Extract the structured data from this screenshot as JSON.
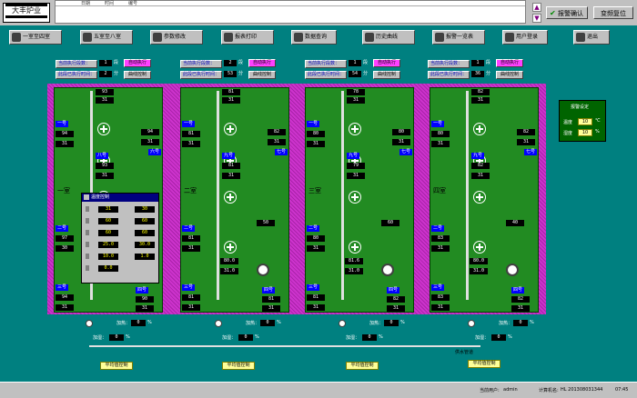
{
  "header": {
    "logo": "大丰炉业",
    "log_cols": [
      "日期",
      "时间",
      "编号"
    ],
    "ack_btn": "报警确认",
    "reset_btn": "变频复位"
  },
  "nav": [
    {
      "label": "一室至四室",
      "icon": "screen-icon"
    },
    {
      "label": "五室至八室",
      "icon": "screen-icon"
    },
    {
      "label": "参数修改",
      "icon": "wrench-icon"
    },
    {
      "label": "报表打印",
      "icon": "printer-icon"
    },
    {
      "label": "数据查询",
      "icon": "search-icon"
    },
    {
      "label": "历史曲线",
      "icon": "help-icon"
    },
    {
      "label": "报警一览表",
      "icon": "alarm-icon"
    },
    {
      "label": "用户登录",
      "icon": "key-icon"
    },
    {
      "label": "退出",
      "icon": "exit-icon"
    }
  ],
  "ctrl": {
    "l1": "当前执行段数：",
    "l2": "此段已执行时间：",
    "run": "自动执行",
    "curve": "曲线控制",
    "seg_unit": "段",
    "time_unit": "分",
    "rooms": [
      {
        "seg": "1",
        "time": "2"
      },
      {
        "seg": "2",
        "time": "53"
      },
      {
        "seg": "1",
        "time": "54"
      },
      {
        "seg": "1",
        "time": "36"
      }
    ]
  },
  "rooms": [
    {
      "name": "一室",
      "tag1": "一号",
      "v1": "94",
      "v2": "31",
      "tag2": "二号",
      "v3": "97",
      "v4": "30",
      "tag3": "三号",
      "v5": "94",
      "v6": "31",
      "t_mid": "93",
      "t_mid2": "31",
      "tr1": "94",
      "tr2": "31",
      "tag_r": "六号",
      "tag4": "八号",
      "v7": "93",
      "v8": "31",
      "tag_r3": "四号",
      "vr3": "90",
      "vr4": "31"
    },
    {
      "name": "二室",
      "tag1": "一号",
      "v1": "81",
      "v2": "31",
      "tag2": "二号",
      "v3": "81",
      "v4": "31",
      "tag3": "三号",
      "v5": "81",
      "v6": "31",
      "t_mid": "81",
      "t_mid2": "31",
      "tr1": "82",
      "tr2": "31",
      "tag_r": "七号",
      "tag4": "九号",
      "v7": "81",
      "v8": "31",
      "tag_r3": "四号",
      "vr3": "81",
      "vr4": "31"
    },
    {
      "name": "三室",
      "tag1": "一号",
      "v1": "80",
      "v2": "31",
      "tag2": "二号",
      "v3": "80",
      "v4": "31",
      "tag3": "三号",
      "v5": "81",
      "v6": "31",
      "t_mid": "78",
      "t_mid2": "31",
      "tr1": "80",
      "tr2": "31",
      "tag_r": "七号",
      "tag4": "九号",
      "v7": "79",
      "v8": "31",
      "tag_r3": "四号",
      "vr3": "82",
      "vr4": "31"
    },
    {
      "name": "四室",
      "tag1": "一号",
      "v1": "80",
      "v2": "31",
      "tag2": "二号",
      "v3": "83",
      "v4": "31",
      "tag3": "三号",
      "v5": "83",
      "v6": "31",
      "t_mid": "82",
      "t_mid2": "31",
      "tr1": "82",
      "tr2": "31",
      "tag_r": "七号",
      "tag4": "九号",
      "v7": "82",
      "v8": "31",
      "tag_r3": "四号",
      "vr3": "82",
      "vr4": "31"
    }
  ],
  "mid_vals": [
    "36",
    "50",
    "60",
    "40"
  ],
  "low_vals": [
    "81.1",
    "80.0",
    "81.6",
    "80.0"
  ],
  "low_vals2": [
    "31.1",
    "31.0",
    "31.0",
    "31.0"
  ],
  "popup": {
    "title": "温度控制",
    "rows": [
      [
        "31",
        "30"
      ],
      [
        "60",
        "60"
      ],
      [
        "60",
        "60"
      ],
      [
        "25.0",
        "30.0"
      ],
      [
        "10.0",
        "1.0"
      ],
      [
        "0.0",
        ""
      ]
    ]
  },
  "alarmset": {
    "title": "报警设定",
    "l1": "温度",
    "v1": "10",
    "l2": "湿度",
    "v2": "10",
    "u1": "℃",
    "u2": "%"
  },
  "bottom": {
    "heat": "加热：",
    "humid": "加湿：",
    "zero": "0",
    "pct": "%",
    "pipe": "供水管道",
    "btn": "平均值控制"
  },
  "status": {
    "user_label": "当前用户:",
    "user": "admin",
    "pc_label": "计算机名:",
    "pc": "HL 201308031344",
    "time": "07:45"
  },
  "unit_c": "℃",
  "unit_p": "%"
}
